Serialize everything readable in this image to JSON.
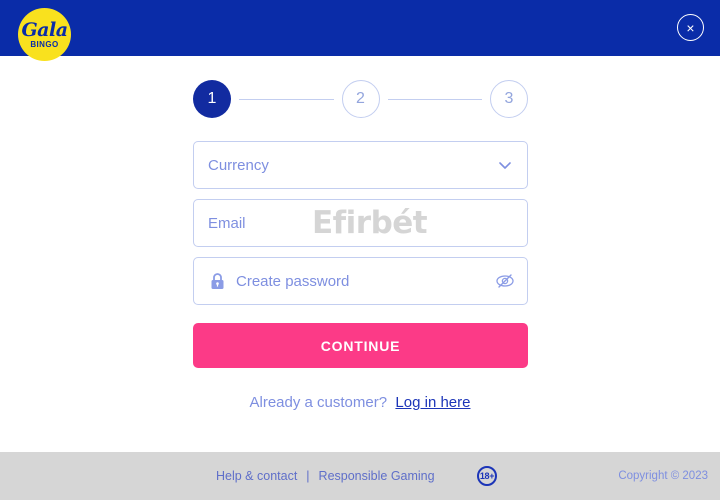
{
  "header": {
    "logo": {
      "name_top": "Gala",
      "name_bottom": "BINGO",
      "circle_color": "#f9e11e",
      "text_color": "#0a2ca8"
    },
    "close_label": "×",
    "background_color": "#0a2ca8"
  },
  "stepper": {
    "steps": [
      {
        "number": "1",
        "state": "active"
      },
      {
        "number": "2",
        "state": "inactive"
      },
      {
        "number": "3",
        "state": "inactive"
      }
    ],
    "active_color": "#122ba0",
    "inactive_border_color": "#c3cef0",
    "inactive_text_color": "#93a5dd"
  },
  "form": {
    "currency": {
      "placeholder": "Currency",
      "value": "",
      "icon": "chevron-down-icon"
    },
    "email": {
      "placeholder": "Email",
      "value": "",
      "watermark": "Efirbét"
    },
    "password": {
      "placeholder": "Create password",
      "value": "",
      "left_icon": "lock-icon",
      "right_icon": "eye-off-icon"
    },
    "submit_label": "CONTINUE",
    "submit_color": "#fc3a87"
  },
  "login": {
    "prompt": "Already a customer?",
    "link_label": "Log in here",
    "link_color": "#1c35b8"
  },
  "footer": {
    "help_label": "Help & contact",
    "separator": "|",
    "responsible_label": "Responsible Gaming",
    "age_badge": "18+",
    "copyright": "Copyright © 2023",
    "background_color": "#d6d6d6"
  }
}
